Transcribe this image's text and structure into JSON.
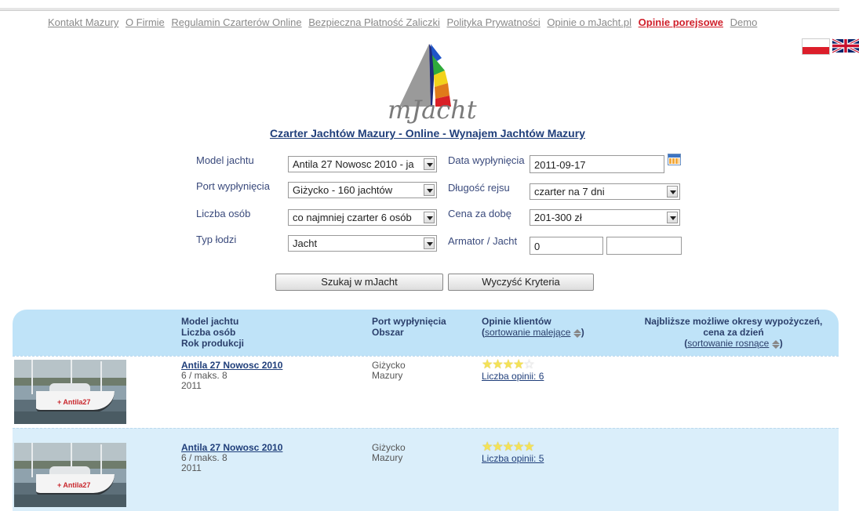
{
  "nav": {
    "items": [
      "Kontakt Mazury",
      "O Firmie",
      "Regulamin Czarterów Online",
      "Bezpieczna Płatność Zaliczki",
      "Polityka Prywatności",
      "Opinie o mJacht.pl",
      "Opinie porejsowe",
      "Demo"
    ],
    "active": "Opinie porejsowe",
    "active_color": "#d01f2a"
  },
  "logo": {
    "text": "mJacht"
  },
  "title": "Czarter Jachtów Mazury - Online - Wynajem Jachtów Mazury",
  "form": {
    "model": {
      "label": "Model jachtu",
      "value": "Antila 27 Nowosc 2010 - ja"
    },
    "port": {
      "label": "Port wypłynięcia",
      "value": "Giżycko - 160 jachtów"
    },
    "persons": {
      "label": "Liczba osób",
      "value": "co najmniej czarter 6 osób"
    },
    "boat_type": {
      "label": "Typ łodzi",
      "value": "Jacht"
    },
    "date": {
      "label": "Data wypłynięcia",
      "value": "2011-09-17"
    },
    "length": {
      "label": "Długość rejsu",
      "value": "czarter na 7 dni"
    },
    "price": {
      "label": "Cena za dobę",
      "value": "201-300 zł"
    },
    "owner": {
      "label": "Armator / Jacht",
      "value1": "0",
      "value2": ""
    },
    "search_button": "Szukaj w mJacht",
    "clear_button": "Wyczyść Kryteria"
  },
  "table": {
    "col1": [
      "Model jachtu",
      "Liczba osób",
      "Rok produkcji"
    ],
    "col2": [
      "Port wypłynięcia",
      "Obszar"
    ],
    "col3": {
      "title": "Opinie klientów",
      "sort_link": "sortowanie malejące",
      "close": ")",
      "open": "("
    },
    "col4": {
      "line1": "Najbliższe możliwe okresy wypożyczeń,",
      "line2": "cena za dzień",
      "sort_link": "sortowanie rosnące",
      "open": "(",
      "close": ")"
    },
    "rows": [
      {
        "model": "Antila 27 Nowosc 2010",
        "persons": "6 / maks. 8",
        "year": "2011",
        "port": "Giżycko",
        "area": "Mazury",
        "rating": 4,
        "reviews": "Liczba opinii: 6",
        "photo_label": "Antila27"
      },
      {
        "model": "Antila 27 Nowosc 2010",
        "persons": "6 / maks. 8",
        "year": "2011",
        "port": "Giżycko",
        "area": "Mazury",
        "rating": 5,
        "reviews": "Liczba opinii: 5",
        "photo_label": "Antila27"
      }
    ]
  },
  "colors": {
    "header_bg": "#bfe3f8",
    "alt_row_bg": "#daeefa",
    "link_blue": "#1f3e7a"
  }
}
